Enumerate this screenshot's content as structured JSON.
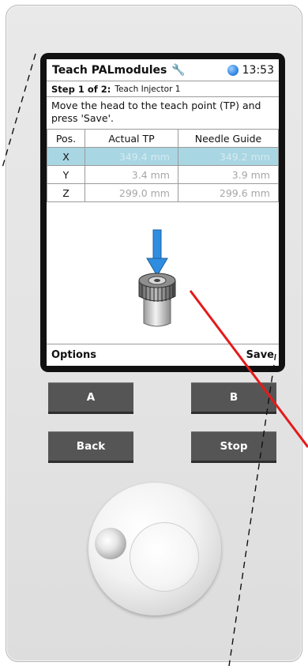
{
  "header": {
    "title": "Teach PALmodules",
    "time": "13:53",
    "icons": [
      "wrench-icon",
      "status-dot-icon"
    ]
  },
  "step": {
    "label": "Step 1 of 2:",
    "name": "Teach Injector 1"
  },
  "instruction": "Move the head to the teach point (TP) and press 'Save'.",
  "table": {
    "headers": [
      "Pos.",
      "Actual TP",
      "Needle Guide"
    ],
    "rows": [
      {
        "pos": "X",
        "actual": "349.4 mm",
        "guide": "349.2 mm"
      },
      {
        "pos": "Y",
        "actual": "3.4 mm",
        "guide": "3.9 mm"
      },
      {
        "pos": "Z",
        "actual": "299.0 mm",
        "guide": "299.6 mm"
      }
    ]
  },
  "illustration": {
    "icons": [
      "down-arrow-icon",
      "injector-icon"
    ],
    "arrow_color": "#2f8de0"
  },
  "footer": {
    "left": "Options",
    "right": "Save"
  },
  "hardware_buttons": {
    "a": "A",
    "b": "B",
    "back": "Back",
    "stop": "Stop"
  },
  "colors": {
    "selected_row": "#a9d6e3",
    "button": "#555555",
    "annotation": "#e31b1b"
  }
}
